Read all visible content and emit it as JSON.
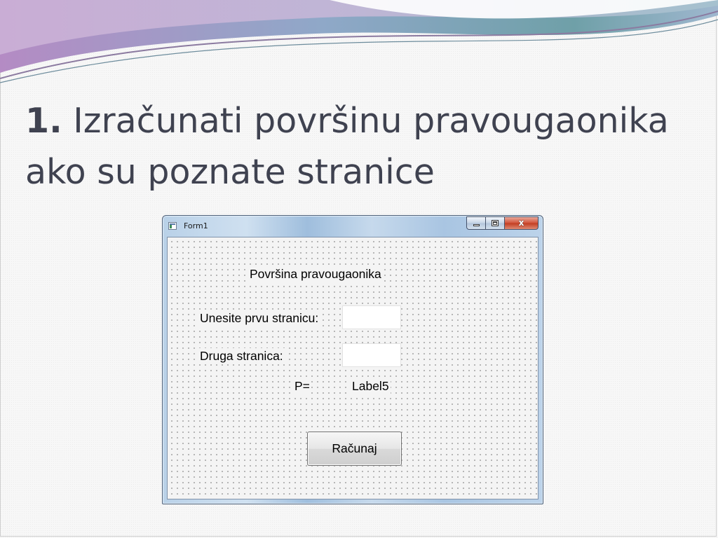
{
  "slide": {
    "title_number": "1.",
    "title_text": " Izračunati površinu pravougaonika ako su poznate stranice"
  },
  "window": {
    "title": "Form1",
    "close_glyph": "x",
    "icon": "app-form-icon"
  },
  "form": {
    "heading_label": "Površina pravougaonika",
    "first_side_label": "Unesite prvu stranicu:",
    "first_side_value": "",
    "second_side_label": "Druga stranica:",
    "second_side_value": "",
    "result_prefix": "P=",
    "result_label": "Label5",
    "calculate_button": "Računaj"
  },
  "colors": {
    "title_text": "#3f4250",
    "window_border": "#4c5f78",
    "close_button": "#c23d22"
  }
}
